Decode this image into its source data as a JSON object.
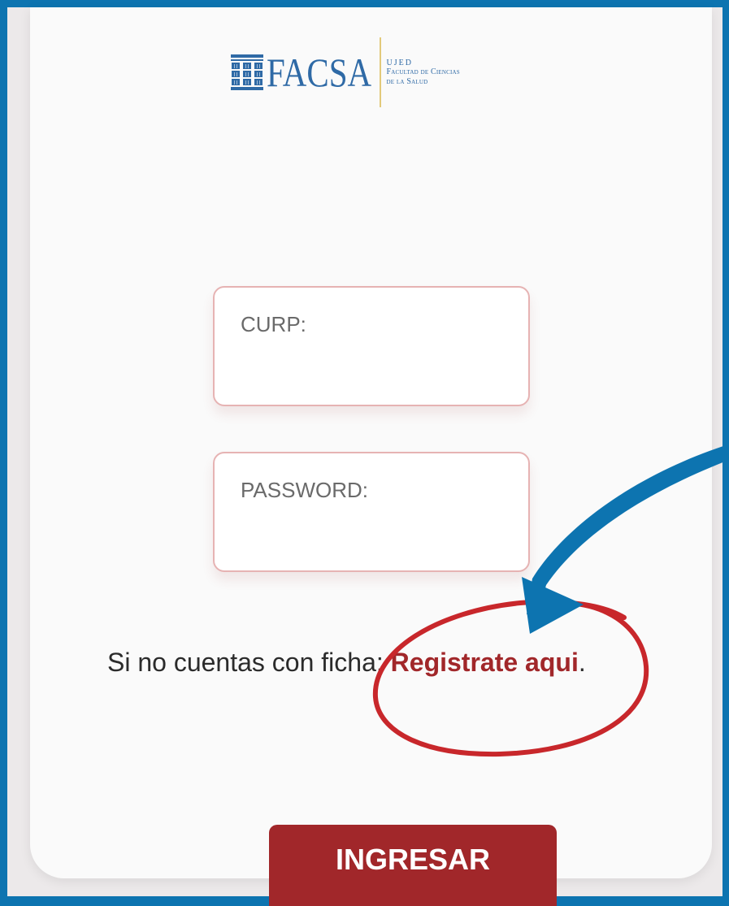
{
  "logo": {
    "name": "FACSA",
    "ujed": "UJED",
    "line1": "Facultad de Ciencias",
    "line2": "de la Salud"
  },
  "form": {
    "curp_placeholder": "CURP:",
    "password_placeholder": "PASSWORD:",
    "register_text": "Si no cuentas con ficha: ",
    "register_link_line1": "Registrate",
    "register_link_line2": "aqui",
    "register_suffix": ".",
    "submit_label": "INGRESAR"
  },
  "colors": {
    "frame_blue": "#0d74b0",
    "accent_red": "#a1272a",
    "logo_blue": "#2f6aa6",
    "circle_red": "#c8272b"
  },
  "annotations": {
    "arrow_icon": "curved-arrow-icon",
    "circle_icon": "highlight-circle-icon"
  }
}
